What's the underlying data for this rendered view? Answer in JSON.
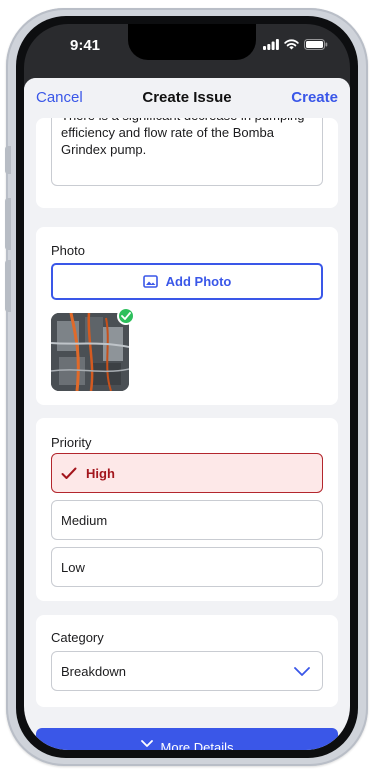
{
  "status_bar": {
    "time": "9:41"
  },
  "nav": {
    "cancel": "Cancel",
    "title": "Create Issue",
    "create": "Create"
  },
  "description": {
    "text": "There is a significant decrease in pumping efficiency and flow rate of the Bomba Grindex pump."
  },
  "photo": {
    "label": "Photo",
    "add_button": "Add Photo",
    "icons": [
      "image-icon",
      "check-circle-icon"
    ]
  },
  "priority": {
    "label": "Priority",
    "options": [
      "High",
      "Medium",
      "Low"
    ],
    "selected": "High"
  },
  "category": {
    "label": "Category",
    "value": "Breakdown"
  },
  "more_details": {
    "label": "More Details"
  },
  "colors": {
    "accent": "#3a57e8",
    "selected_bg": "#fde8e8",
    "selected_border": "#b3262d",
    "success": "#2dbf5c"
  }
}
